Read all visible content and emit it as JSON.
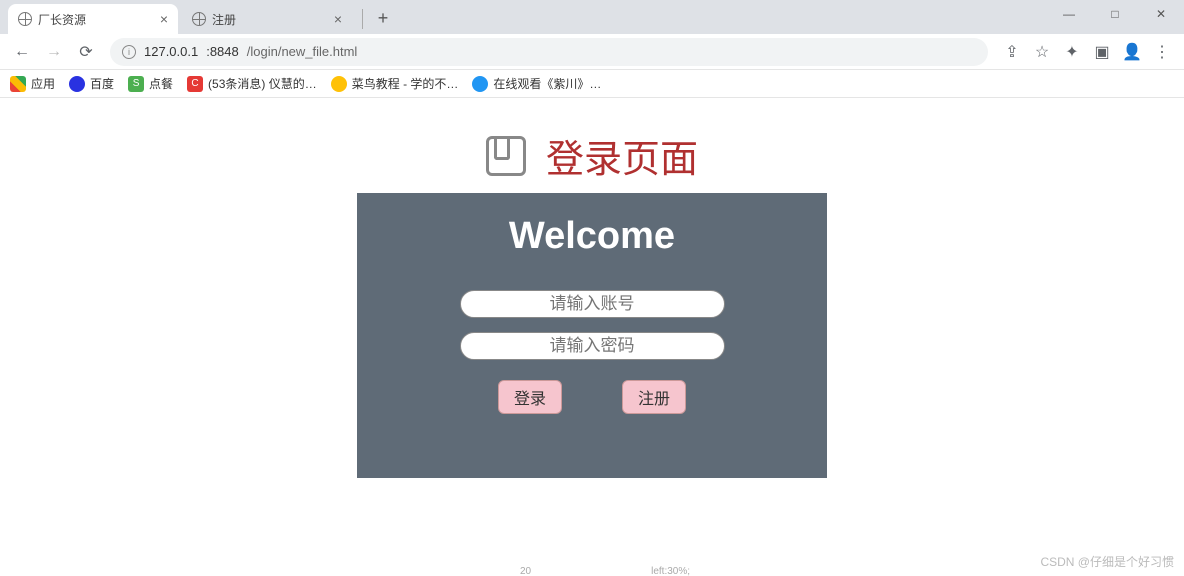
{
  "window": {
    "minimize": "—",
    "maximize": "□",
    "close": "✕"
  },
  "tabs": [
    {
      "title": "厂长资源",
      "active": true
    },
    {
      "title": "注册",
      "active": false
    }
  ],
  "address": {
    "host": "127.0.0.1",
    "port": ":8848",
    "path": "/login/new_file.html"
  },
  "toolbar_icons": {
    "share": "⇪",
    "star": "☆",
    "ext": "✦",
    "panel": "▣",
    "profile": "👤",
    "menu": "⋮"
  },
  "bookmarks": [
    {
      "label": "应用",
      "iconClass": "apps"
    },
    {
      "label": "百度",
      "iconClass": "baidu"
    },
    {
      "label": "点餐",
      "iconClass": "green",
      "iconText": "S"
    },
    {
      "label": "(53条消息) 仪慧的…",
      "iconClass": "red",
      "iconText": "C"
    },
    {
      "label": "菜鸟教程 - 学的不…",
      "iconClass": "yellow"
    },
    {
      "label": "在线观看《紫川》…",
      "iconClass": "blue"
    }
  ],
  "page": {
    "title": "登录页面",
    "welcome": "Welcome",
    "username_placeholder": "请输入账号",
    "password_placeholder": "请输入密码",
    "login_label": "登录",
    "register_label": "注册"
  },
  "watermark": "CSDN @仔细是个好习惯",
  "bottom_fragments": [
    "",
    "20",
    "left:30%;"
  ]
}
